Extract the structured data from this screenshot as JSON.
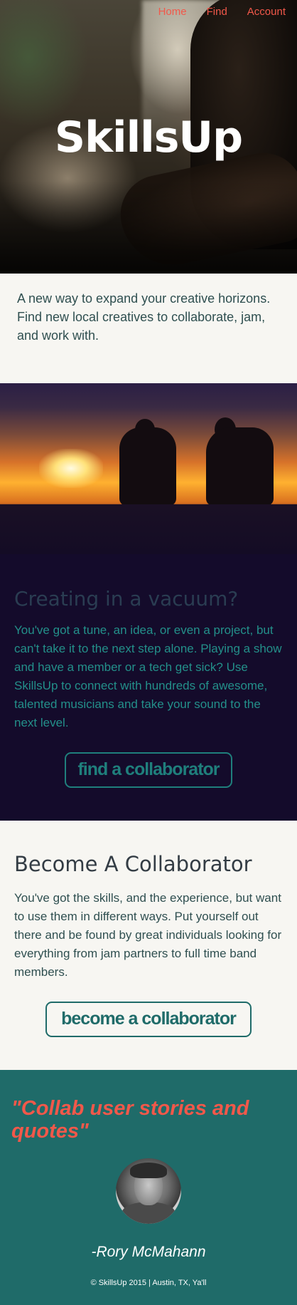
{
  "nav": {
    "items": [
      "Home",
      "Find",
      "Account"
    ]
  },
  "hero": {
    "title": "SkillsUp"
  },
  "intro": {
    "text": "A new way to expand your creative horizons. Find new local creatives to collaborate, jam, and work with."
  },
  "vacuum": {
    "heading": "Creating in a vacuum?",
    "body": "You've got a tune, an idea, or even a project, but can't take it to the next step alone. Playing a show and have a member or a tech get sick? Use SkillsUp to connect with hundreds of awesome, talented musicians and take your sound to the next level.",
    "button": "find a collaborator"
  },
  "become": {
    "heading": "Become A Collaborator",
    "body": "You've got the skills, and the experience, but want to use them in different ways. Put yourself out there and be found by great individuals looking for everything from jam partners to full time band members.",
    "button": "become a collaborator"
  },
  "quote": {
    "text": "\"Collab user stories and quotes\"",
    "author": "-Rory McMahann"
  },
  "footer": {
    "text": "© SkillsUp 2015 | Austin, TX, Ya'll"
  },
  "colors": {
    "accent": "#f2584a",
    "teal": "#1f6b69",
    "dark_purple": "#140b2b",
    "cream": "#f7f6f2"
  }
}
